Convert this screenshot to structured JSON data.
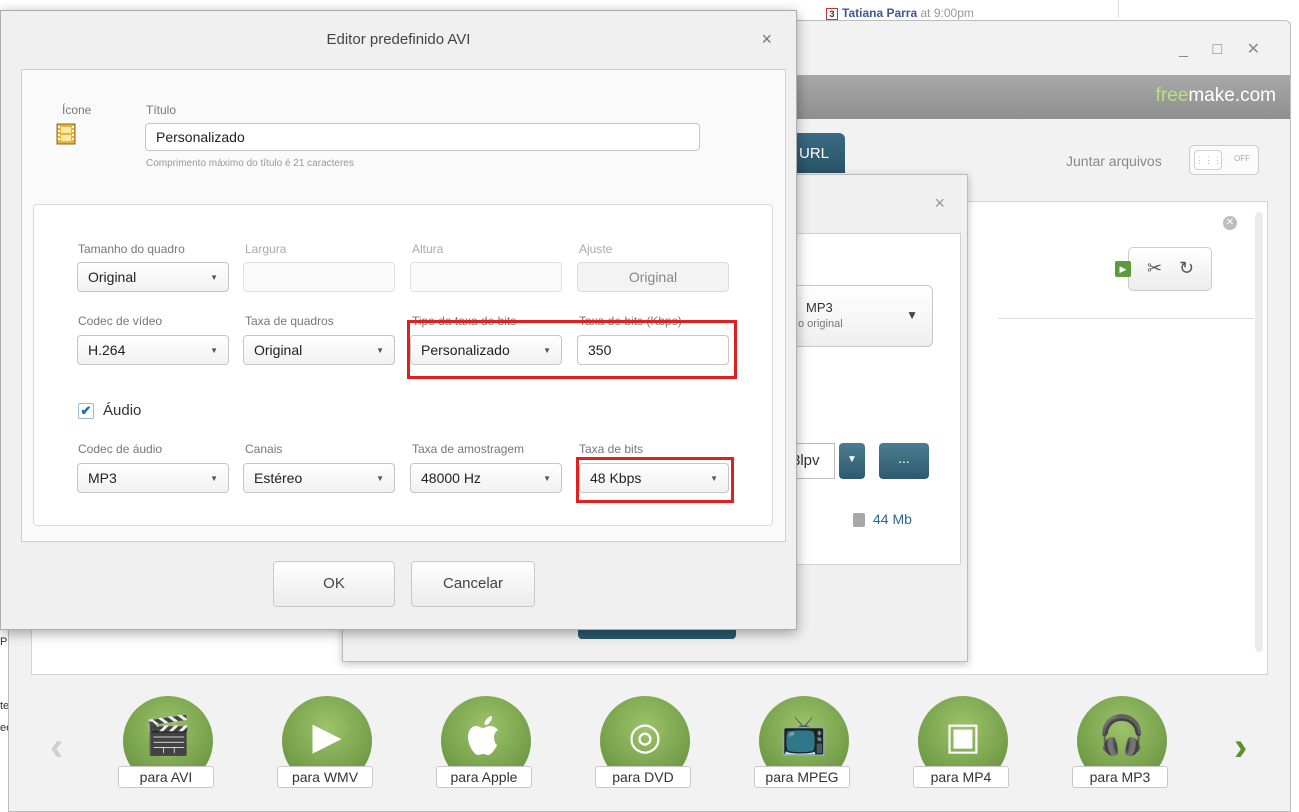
{
  "background": {
    "notification": {
      "badge": "3",
      "name": "Tatiana Parra",
      "suffix": " at 9:00pm"
    },
    "edge_bits": [
      "P",
      "tei",
      "ee"
    ]
  },
  "main_window": {
    "controls": "_ □ ✕",
    "brand_free": "free",
    "brand_rest": "make.com",
    "url_tab": "URL",
    "join_label": "Juntar arquivos",
    "toggle_state": "OFF"
  },
  "middle_dialog": {
    "close": "×",
    "format_title": "MP3",
    "format_sub": "o original",
    "resolution_partial": "3lpv",
    "dots": "...",
    "size": "44 Mb"
  },
  "dialog": {
    "title": "Editor predefinido AVI",
    "close": "×",
    "icon_label": "Ícone",
    "title_label": "Título",
    "title_value": "Personalizado",
    "title_hint": "Comprimento máximo do título é 21 caracteres",
    "frame_size_label": "Tamanho do quadro",
    "frame_size_value": "Original",
    "width_label": "Largura",
    "height_label": "Altura",
    "fit_label": "Ajuste",
    "fit_value": "Original",
    "video_codec_label": "Codec de vídeo",
    "video_codec_value": "H.264",
    "frame_rate_label": "Taxa de quadros",
    "frame_rate_value": "Original",
    "bitrate_type_label": "Tipo da taxa de bits",
    "bitrate_type_value": "Personalizado",
    "bitrate_label": "Taxa de bits (Kbps)",
    "bitrate_value": "350",
    "audio_label": "Áudio",
    "audio_checked": "✔",
    "audio_codec_label": "Codec de áudio",
    "audio_codec_value": "MP3",
    "channels_label": "Canais",
    "channels_value": "Estéreo",
    "sample_rate_label": "Taxa de amostragem",
    "sample_rate_value": "48000 Hz",
    "audio_bitrate_label": "Taxa de bits",
    "audio_bitrate_value": "48 Kbps",
    "ok": "OK",
    "cancel": "Cancelar"
  },
  "format_bar": {
    "prev": "‹",
    "next": "›",
    "items": [
      {
        "label": "para AVI",
        "glyph": "🎬",
        "icon": "clapper-icon"
      },
      {
        "label": "para WMV",
        "glyph": "▶",
        "icon": "media-player-icon"
      },
      {
        "label": "para Apple",
        "glyph": "",
        "icon": "apple-icon"
      },
      {
        "label": "para DVD",
        "glyph": "◎",
        "icon": "disc-icon"
      },
      {
        "label": "para MPEG",
        "glyph": "📺",
        "icon": "tv-icon"
      },
      {
        "label": "para MP4",
        "glyph": "▣",
        "icon": "mp4-player-icon"
      },
      {
        "label": "para MP3",
        "glyph": "🎧",
        "icon": "earphones-icon"
      }
    ]
  },
  "colors": {
    "accent_teal": "#2d5a6e",
    "format_green": "#6f9a45",
    "highlight_red": "#e02020",
    "brand_green": "#b7e27a"
  }
}
